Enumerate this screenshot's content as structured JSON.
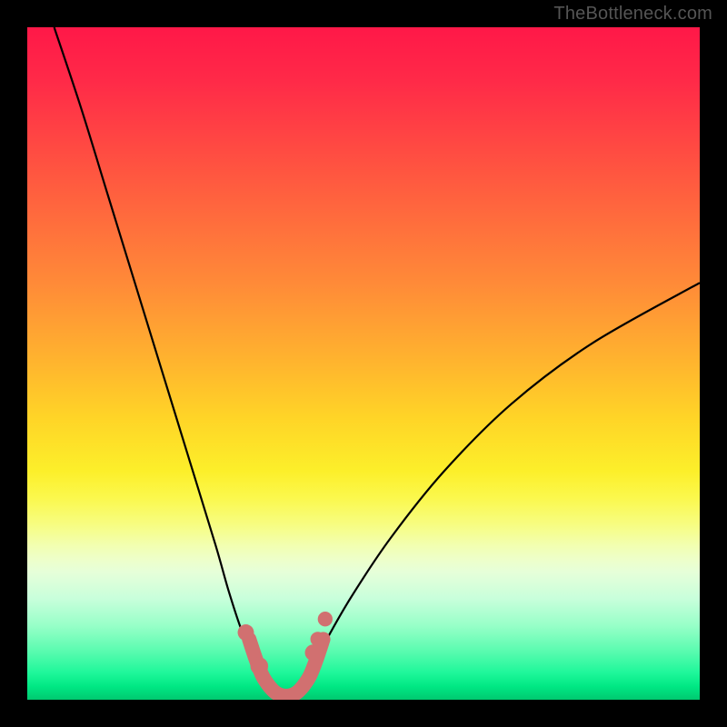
{
  "watermark": "TheBottleneck.com",
  "colors": {
    "frame": "#000000",
    "curve_stroke": "#000000",
    "marker_fill": "#d17070",
    "marker_stroke": "#d17070",
    "gradient_top": "#ff1848",
    "gradient_bottom": "#00c970"
  },
  "chart_data": {
    "type": "line",
    "title": "",
    "xlabel": "",
    "ylabel": "",
    "xlim": [
      0,
      100
    ],
    "ylim": [
      0,
      100
    ],
    "grid": false,
    "series": [
      {
        "name": "left-curve",
        "x": [
          4,
          8,
          12,
          16,
          20,
          24,
          28,
          30,
          32,
          34,
          36,
          37,
          38
        ],
        "y": [
          100,
          88,
          75,
          62,
          49,
          36,
          23,
          16,
          10,
          6,
          3,
          1.5,
          0.5
        ]
      },
      {
        "name": "right-curve",
        "x": [
          38,
          40,
          42,
          44,
          48,
          54,
          62,
          72,
          84,
          100
        ],
        "y": [
          0.5,
          1.5,
          4,
          8,
          15,
          24,
          34,
          44,
          53,
          62
        ]
      },
      {
        "name": "trough-band",
        "x": [
          33,
          34,
          35,
          36,
          37,
          38,
          39,
          40,
          41,
          42,
          43,
          44
        ],
        "y": [
          9,
          6,
          3.5,
          2,
          1,
          0.6,
          0.6,
          1,
          2,
          3.5,
          6,
          9
        ]
      }
    ],
    "markers": [
      {
        "x": 32.5,
        "y": 10,
        "r": 1.1
      },
      {
        "x": 34.5,
        "y": 5,
        "r": 1.2
      },
      {
        "x": 42.5,
        "y": 7,
        "r": 1.1
      },
      {
        "x": 43.2,
        "y": 9,
        "r": 1.0
      },
      {
        "x": 44.3,
        "y": 12,
        "r": 1.0
      }
    ],
    "annotations": []
  }
}
